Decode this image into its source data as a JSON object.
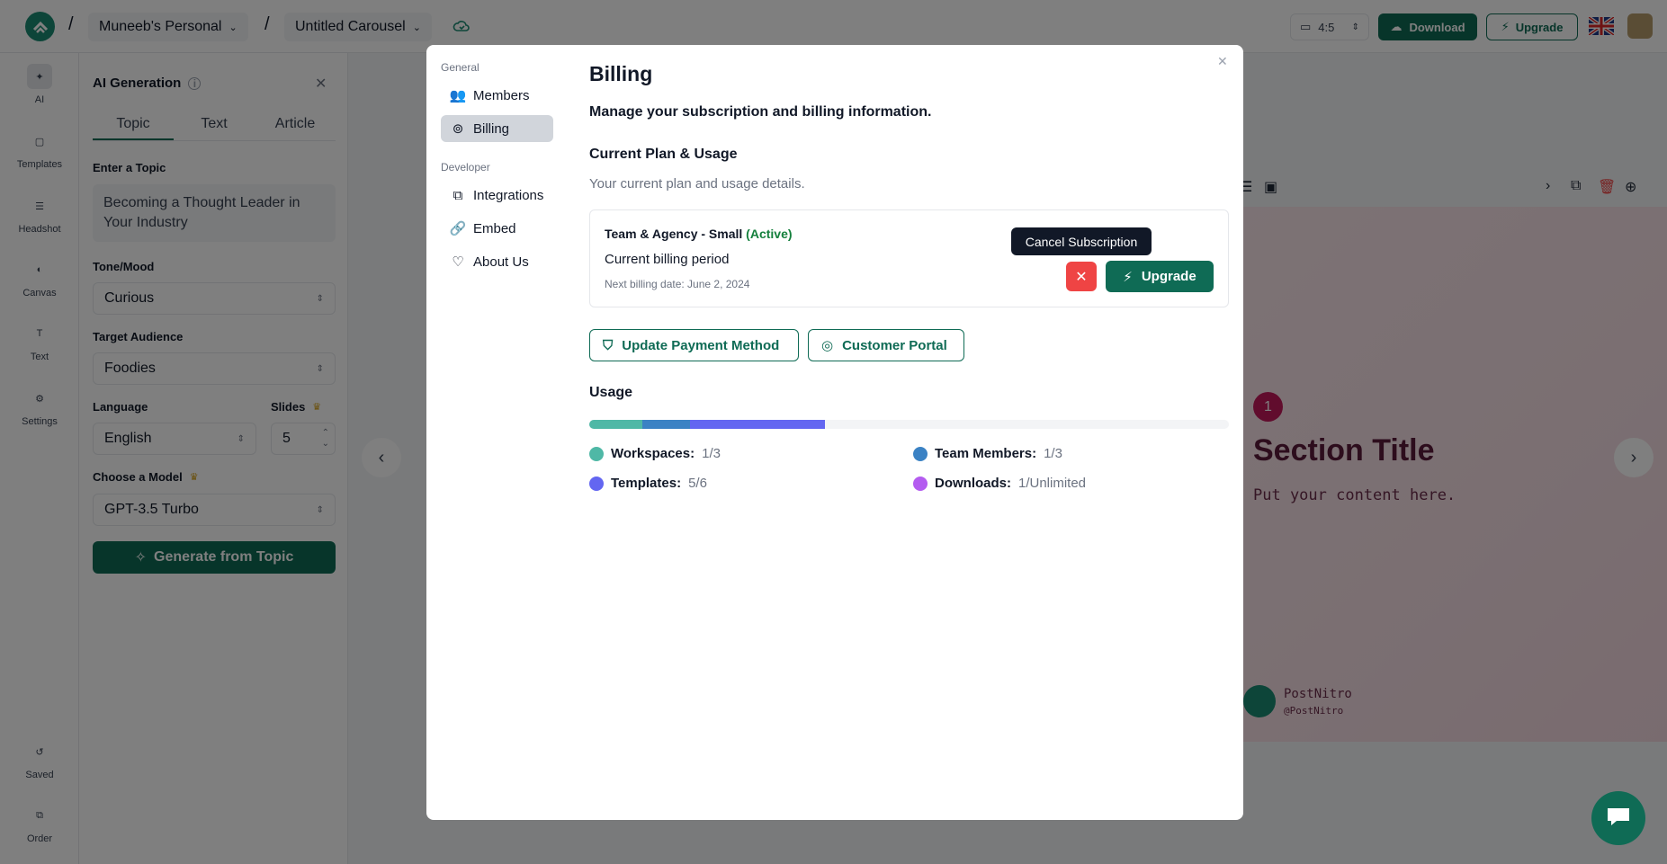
{
  "topbar": {
    "workspace": "Muneeb's Personal",
    "document": "Untitled Carousel",
    "ratio": "4:5",
    "download_label": "Download",
    "upgrade_label": "Upgrade",
    "separator": "/"
  },
  "rail": {
    "items": [
      {
        "label": "AI"
      },
      {
        "label": "Templates"
      },
      {
        "label": "Headshot"
      },
      {
        "label": "Canvas"
      },
      {
        "label": "Text"
      },
      {
        "label": "Settings"
      }
    ],
    "bottom": [
      {
        "label": "Saved"
      },
      {
        "label": "Order"
      }
    ]
  },
  "panel": {
    "title": "AI Generation",
    "tabs": [
      "Topic",
      "Text",
      "Article"
    ],
    "active_tab": "Topic",
    "topic_label": "Enter a Topic",
    "topic_value": "Becoming a Thought Leader in Your Industry",
    "tone_label": "Tone/Mood",
    "tone_value": "Curious",
    "audience_label": "Target Audience",
    "audience_value": "Foodies",
    "language_label": "Language",
    "language_value": "English",
    "slides_label": "Slides",
    "slides_value": "5",
    "model_label": "Choose a Model",
    "model_value": "GPT-3.5 Turbo",
    "generate_label": "Generate from Topic"
  },
  "slide": {
    "number": "1",
    "title": "Section Title",
    "body": "Put your content here.",
    "brand_name": "PostNitro",
    "brand_handle": "@PostNitro"
  },
  "modal": {
    "nav": {
      "general_label": "General",
      "developer_label": "Developer",
      "items": [
        {
          "label": "Members"
        },
        {
          "label": "Billing"
        },
        {
          "label": "Integrations"
        },
        {
          "label": "Embed"
        },
        {
          "label": "About Us"
        }
      ]
    },
    "title": "Billing",
    "subtitle": "Manage your subscription and billing information.",
    "plan_heading": "Current Plan & Usage",
    "plan_desc": "Your current plan and usage details.",
    "plan": {
      "name": "Team & Agency - Small",
      "status": "(Active)",
      "period": "Current billing period",
      "next_billing": "Next billing date: June 2, 2024"
    },
    "tooltip": "Cancel Subscription",
    "upgrade_label": "Upgrade",
    "update_payment_label": "Update Payment Method",
    "customer_portal_label": "Customer Portal",
    "usage_heading": "Usage",
    "usage": [
      {
        "name": "Workspaces:",
        "value": "1/3",
        "used": 1,
        "limit": 3,
        "color": "#4fb8a6"
      },
      {
        "name": "Team Members:",
        "value": "1/3",
        "used": 1,
        "limit": 3,
        "color": "#3b82c4"
      },
      {
        "name": "Templates:",
        "value": "5/6",
        "used": 5,
        "limit": 6,
        "color": "#6366f1"
      },
      {
        "name": "Downloads:",
        "value": "1/Unlimited",
        "used": 1,
        "limit": null,
        "color": "#b45cf0"
      }
    ],
    "usage_bar_fill": [
      0.083,
      0.075,
      0.21
    ]
  },
  "colors": {
    "brand": "#0f6b55",
    "danger": "#ef4444",
    "active": "#15803d"
  }
}
